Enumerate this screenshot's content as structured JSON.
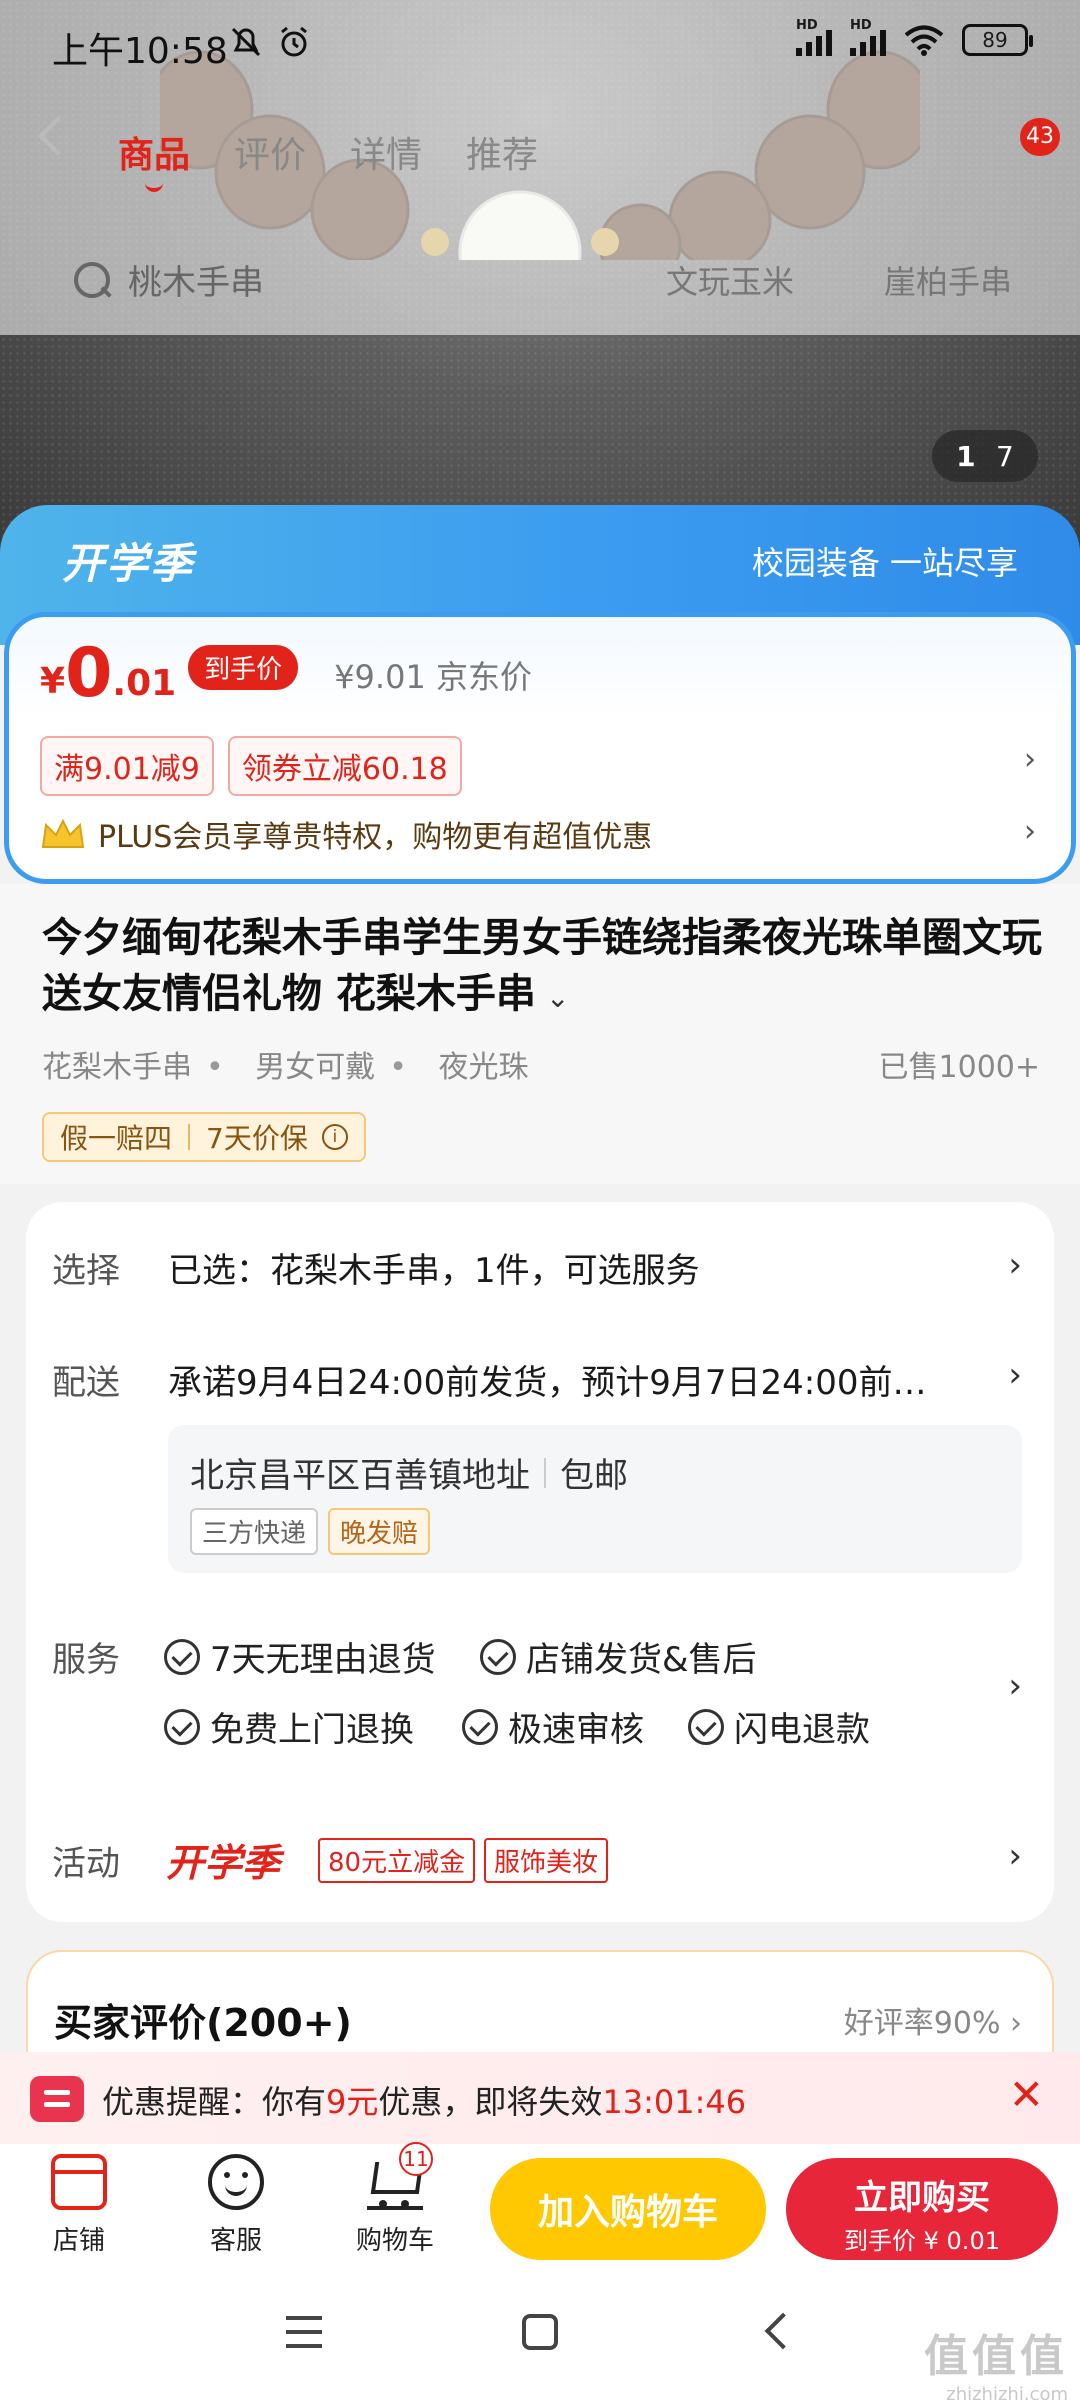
{
  "status_bar": {
    "time": "上午10:58",
    "battery": "89",
    "hd": "HD"
  },
  "nav": {
    "tabs": [
      {
        "label": "商品",
        "active": true
      },
      {
        "label": "评价",
        "active": false
      },
      {
        "label": "详情",
        "active": false
      },
      {
        "label": "推荐",
        "active": false
      }
    ],
    "message_count": "43"
  },
  "search": {
    "query": "桃木手串",
    "hot_words": [
      "文玩玉米",
      "崖柏手串"
    ]
  },
  "gallery": {
    "current": "1",
    "total": "7"
  },
  "campaign": {
    "title": "开学季",
    "slogan": "校园装备 一站尽享"
  },
  "price": {
    "currency": "¥",
    "int": "0",
    "dec": ".01",
    "hand_price_tag": "到手价",
    "jd_price": "¥9.01 京东价",
    "coupons": [
      "满9.01减9",
      "领券立减60.18"
    ],
    "plus_text": "PLUS会员享尊贵特权，购物更有超值优惠"
  },
  "product": {
    "title": "今夕缅甸花梨木手串学生男女手链绕指柔夜光珠单圈文玩送女友情侣礼物 花梨木手串",
    "tags": [
      "花梨木手串",
      "男女可戴",
      "夜光珠"
    ],
    "sold": "已售1000+",
    "guarantees": [
      "假一赔四",
      "7天价保"
    ]
  },
  "details": {
    "select_label": "选择",
    "select_text": "已选：花梨木手串，1件，可选服务",
    "delivery_label": "配送",
    "delivery_text": "承诺9月4日24:00前发货，预计9月7日24:00前…",
    "address": "北京昌平区百善镇地址",
    "shipping": "包邮",
    "address_tags": [
      "三方快递",
      "晚发赔"
    ],
    "service_label": "服务",
    "services": [
      "7天无理由退货",
      "店铺发货&售后",
      "免费上门退换",
      "极速审核",
      "闪电退款"
    ],
    "activity_label": "活动",
    "activity_logo": "开学季",
    "activity_tags": [
      "80元立减金",
      "服饰美妆"
    ]
  },
  "reviews": {
    "title": "买家评价(200+)",
    "rate": "好评率90%"
  },
  "promo": {
    "prefix": "优惠提醒：你有",
    "amount": "9元",
    "middle": "优惠，即将失效",
    "countdown": "13:01:46"
  },
  "action_bar": {
    "store": "店铺",
    "service": "客服",
    "cart": "购物车",
    "cart_count": "11",
    "add_to_cart": "加入购物车",
    "buy_now": "立即购买",
    "buy_now_sub": "到手价 ¥ 0.01"
  },
  "watermark": {
    "big": "值值值",
    "small": "zhizhizhi.com"
  },
  "colors": {
    "accent_red": "#e2231a",
    "campaign_blue": "#3b9cf0",
    "cart_yellow": "#ffc800"
  }
}
